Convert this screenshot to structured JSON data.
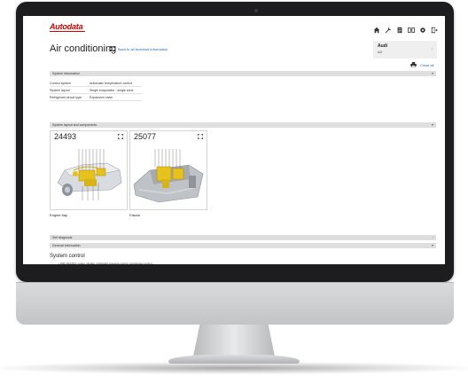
{
  "app": {
    "logo": "Autodata",
    "title": "Air conditioning",
    "back_link": "Back to all technical information"
  },
  "toolbar": {
    "icons": [
      "home-icon",
      "wrench-icon",
      "document-icon",
      "compare-icon",
      "settings-icon",
      "logout-icon"
    ]
  },
  "vehicle": {
    "make": "Audi",
    "model": "A3"
  },
  "actions": {
    "close_all": "Close all"
  },
  "sections": {
    "system_information": "System information",
    "system_layout": "System layout and components",
    "self_diagnosis": "Self diagnosis",
    "general_information": "General information"
  },
  "system_info_rows": [
    {
      "key": "Control system",
      "value": "Automatic temperature control"
    },
    {
      "key": "System layout",
      "value": "Single evaporator - single zone"
    },
    {
      "key": "Refrigerant circuit type",
      "value": "Expansion valve"
    }
  ],
  "diagrams": [
    {
      "number": "24493",
      "caption": "Engine bay"
    },
    {
      "number": "25077",
      "caption": "Fascia"
    }
  ],
  "general": {
    "subheading": "System control",
    "bullet": "• With R1234yf: power, climate, refrigerant pressure control, compressor control..."
  },
  "colors": {
    "brand_red": "#d40000",
    "link_blue": "#1e6ab6",
    "section_bar": "#dedede",
    "bezel": "#1d1d1f"
  }
}
